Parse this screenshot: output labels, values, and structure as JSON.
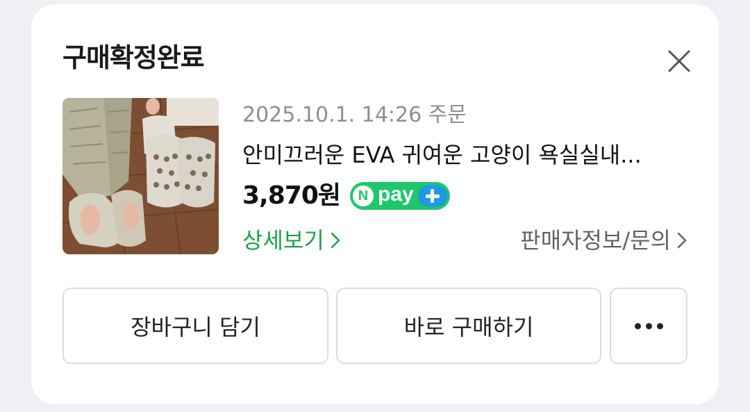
{
  "dialog": {
    "title": "구매확정완료",
    "close_icon": "close-icon"
  },
  "order": {
    "date": "2025.10.1. 14:26 주문",
    "product_name": "안미끄러운 EVA 귀여운 고양이 욕실실내...",
    "price": "3,870원",
    "badge": {
      "n": "N",
      "pay": "pay",
      "plus_icon": "plus-icon"
    },
    "detail_link": "상세보기",
    "seller_link": "판매자정보/문의"
  },
  "actions": {
    "cart_label": "장바구니 담기",
    "buy_label": "바로 구매하기",
    "more_icon": "more-dots-icon"
  },
  "colors": {
    "accent_green": "#1aa34a",
    "npay_green": "#1ec86a",
    "npay_blue": "#1e9be0"
  }
}
